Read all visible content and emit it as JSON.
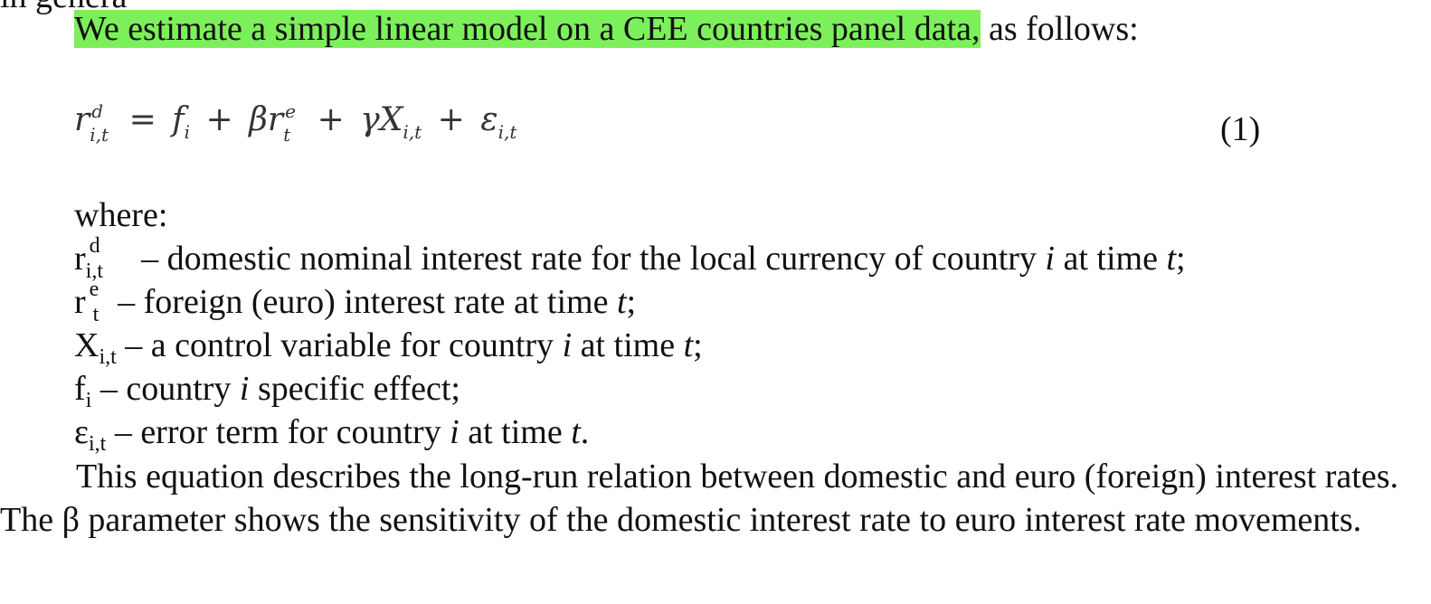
{
  "top_cut_text": "in genera",
  "intro": {
    "highlighted": "We estimate a simple linear model on a CEE countries panel data,",
    "rest": " as follows:"
  },
  "equation": {
    "r": "r",
    "r_sup": "d",
    "r_sub": "i,t",
    "eq": "=",
    "f": "f",
    "f_sub": "i",
    "plus1": "+",
    "beta": "β",
    "r2": "r",
    "r2_sup": "e",
    "r2_sub": "t",
    "plus2": "+",
    "gamma": "γ",
    "X": "X",
    "X_sub": "i,t",
    "plus3": "+",
    "eps": "ε",
    "eps_sub": "i,t",
    "number": "(1)"
  },
  "where_label": "where:",
  "definitions": [
    {
      "sym": "r",
      "sup": "d",
      "sub": "i,t",
      "pre": " – domestic nominal interest rate for the local currency of country ",
      "i": "i",
      "mid": " at time ",
      "t": "t",
      "end": ";"
    },
    {
      "sym": "r",
      "sup": "e",
      "sub": "t",
      "pre": " – foreign (euro) interest rate at time ",
      "t": "t",
      "end": ";"
    },
    {
      "sym": "X",
      "sub": "i,t",
      "pre": " – a control variable for country ",
      "i": "i",
      "mid": " at time ",
      "t": "t",
      "end": ";"
    },
    {
      "sym": "f",
      "sub": "i",
      "pre": " – country ",
      "i": "i",
      "end": " specific effect;"
    },
    {
      "sym": "ε",
      "sub": "i,t",
      "pre": " – error term for country ",
      "i": "i",
      "mid": " at time ",
      "t": "t",
      "end": "."
    }
  ],
  "paragraph": "This equation describes the long-run relation between domestic and euro (foreign) interest rates. The β parameter shows the sensitivity of the domestic interest rate to euro interest rate movements.",
  "colors": {
    "highlight": "#7cf05a",
    "text": "#111111"
  }
}
